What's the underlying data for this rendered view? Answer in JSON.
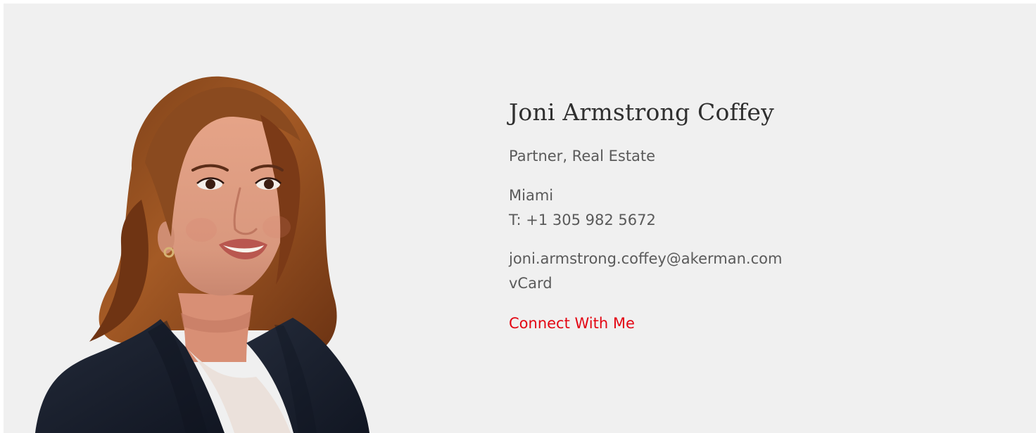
{
  "profile": {
    "name": "Joni Armstrong Coffey",
    "title": "Partner, Real Estate",
    "office": "Miami",
    "phone": "T: +1 305 982 5672",
    "email": "joni.armstrong.coffey@akerman.com",
    "vcard": "vCard",
    "connect": "Connect With Me"
  },
  "colors": {
    "background": "#f0f0f0",
    "name_text": "#2f2f2f",
    "body_text": "#5a5a5a",
    "accent": "#e30613"
  },
  "image": {
    "alt": "Joni Armstrong Coffey"
  }
}
